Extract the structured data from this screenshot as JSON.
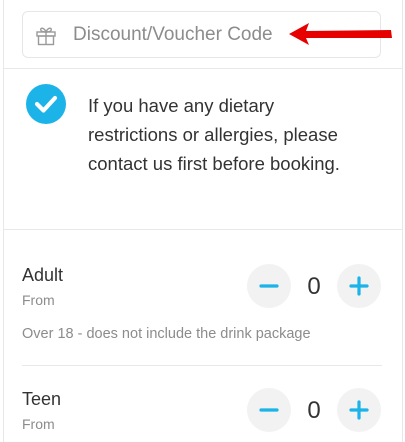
{
  "voucher": {
    "placeholder": "Discount/Voucher Code",
    "icon": "gift-icon"
  },
  "annotation": {
    "icon": "red-arrow-icon",
    "color": "#e60000"
  },
  "notice": {
    "icon": "check-circle-icon",
    "text": "If you have any dietary restrictions or allergies, please contact us first before booking.",
    "color": "#1bb3e8"
  },
  "tickets": [
    {
      "label": "Adult",
      "sub": "From",
      "count": "0",
      "description": "Over 18 - does not include the drink package"
    },
    {
      "label": "Teen",
      "sub": "From",
      "count": "0"
    }
  ],
  "stepper": {
    "minus_icon": "minus-icon",
    "plus_icon": "plus-icon",
    "accent": "#1bb3e8"
  }
}
